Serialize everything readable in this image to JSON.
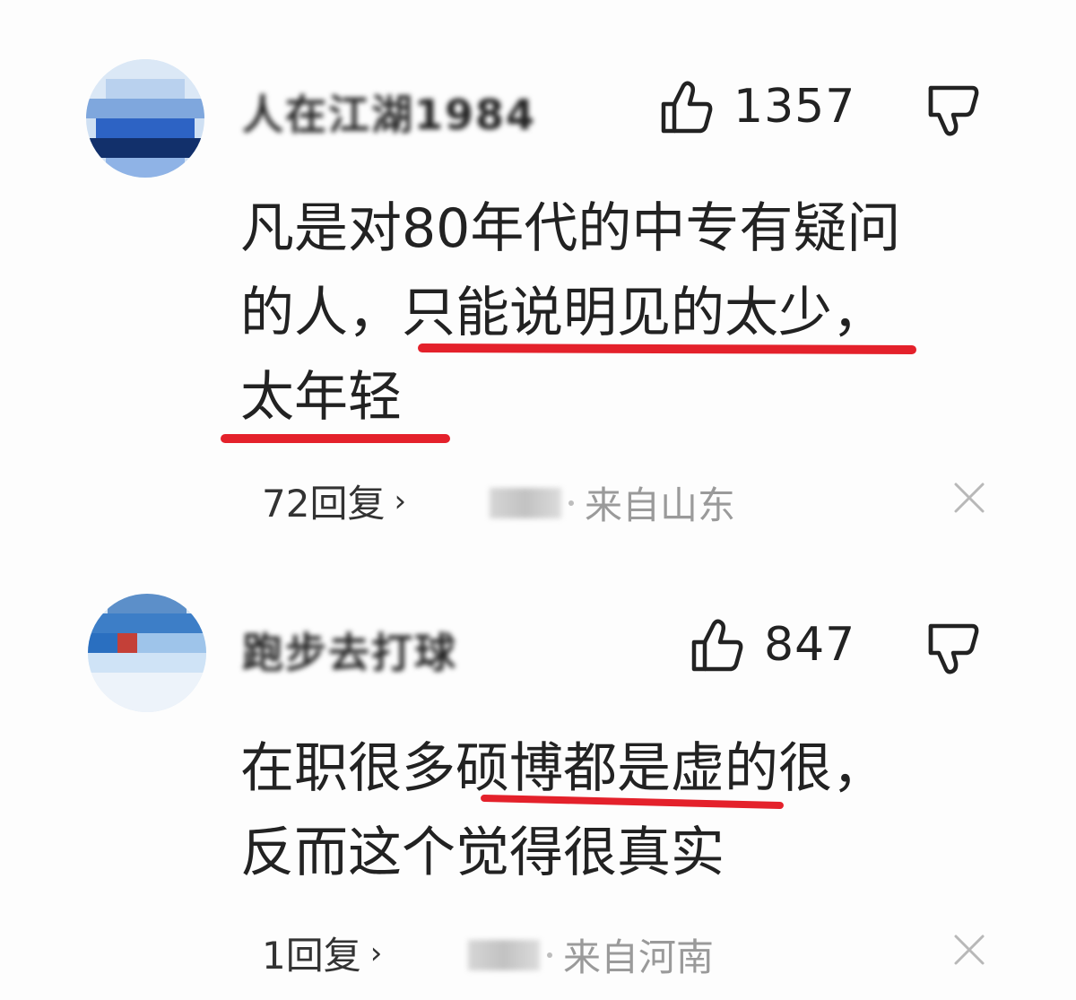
{
  "comments": [
    {
      "username": "人在江湖1984",
      "likes": "1357",
      "text_lines": [
        "凡是对80年代的中专有疑问",
        "的人，只能说明见的太少，",
        "太年轻"
      ],
      "replies": "72回复",
      "chevron": "›",
      "location": "来自山东"
    },
    {
      "username": "跑步去打球",
      "likes": "847",
      "text_lines": [
        "在职很多硕博都是虚的很，",
        "反而这个觉得很真实"
      ],
      "replies": "1回复",
      "chevron": "›",
      "location": "来自河南"
    }
  ],
  "icons": {
    "like": "thumbs-up-outline-icon",
    "dislike": "thumbs-down-outline-icon",
    "close": "close-x-icon"
  },
  "colors": {
    "highlight_underline": "#e4212b",
    "meta_text": "#9a9a9a"
  }
}
